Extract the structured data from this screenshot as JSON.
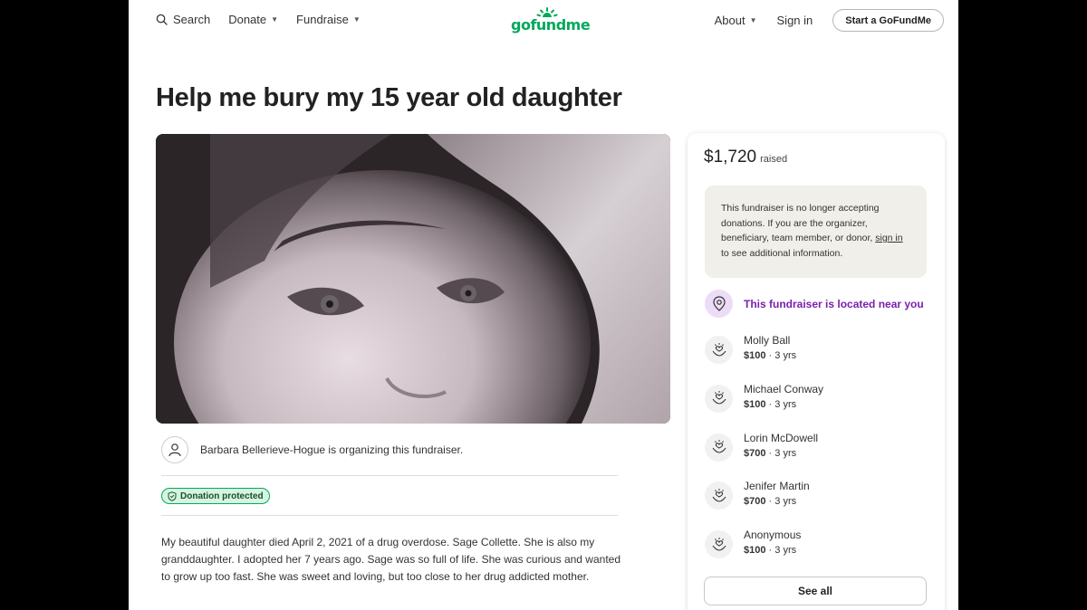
{
  "nav": {
    "search_label": "Search",
    "donate_label": "Donate",
    "fundraise_label": "Fundraise",
    "about_label": "About",
    "signin_label": "Sign in",
    "start_label": "Start a GoFundMe",
    "logo_text": "gofundme"
  },
  "campaign": {
    "title": "Help me bury my 15 year old daughter",
    "organizer_text": "Barbara Bellerieve-Hogue is organizing this fundraiser.",
    "badge_label": "Donation protected",
    "story": "My beautiful daughter died April 2, 2021 of a drug overdose.  Sage Collette.  She is also my granddaughter.  I adopted her 7 years ago.  Sage was so full of life.  She was curious and wanted to grow up too fast.  She was sweet and loving, but too close to her drug addicted mother."
  },
  "card": {
    "raised_amount": "$1,720",
    "raised_label": "raised",
    "notice_pre": "This fundraiser is no longer accepting donations. If you are the organizer, beneficiary, team member, or donor, ",
    "notice_link": "sign in",
    "notice_post": " to see additional information.",
    "near_text": "This fundraiser is located near you",
    "see_all_label": "See all"
  },
  "donors": [
    {
      "name": "Molly Ball",
      "amount": "$100",
      "time": "3 yrs"
    },
    {
      "name": "Michael Conway",
      "amount": "$100",
      "time": "3 yrs"
    },
    {
      "name": "Lorin McDowell",
      "amount": "$700",
      "time": "3 yrs"
    },
    {
      "name": "Jenifer Martin",
      "amount": "$700",
      "time": "3 yrs"
    },
    {
      "name": "Anonymous",
      "amount": "$100",
      "time": "3 yrs"
    }
  ],
  "colors": {
    "brand_green": "#02a95c",
    "near_purple": "#7a1fae",
    "badge_bg": "#d6f5e0"
  },
  "icons": {
    "search": "search-icon",
    "location": "location-pin-icon",
    "donor": "heart-hands-icon",
    "organizer": "user-icon",
    "shield": "shield-icon"
  }
}
